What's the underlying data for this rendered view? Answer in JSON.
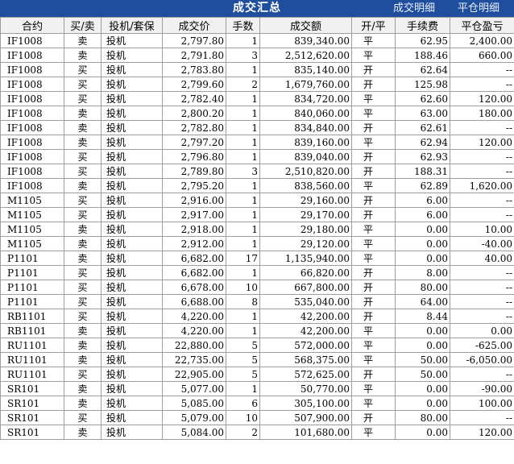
{
  "header": {
    "title": "成交汇总",
    "tab_detail": "成交明细",
    "tab_close_detail": "平仓明细"
  },
  "columns": [
    "合约",
    "买/卖",
    "投机/套保",
    "成交价",
    "手数",
    "成交额",
    "开/平",
    "手续费",
    "平仓盈亏"
  ],
  "rows": [
    [
      "IF1008",
      "卖",
      "投机",
      "2,797.80",
      "1",
      "839,340.00",
      "平",
      "62.95",
      "2,400.00"
    ],
    [
      "IF1008",
      "卖",
      "投机",
      "2,791.80",
      "3",
      "2,512,620.00",
      "平",
      "188.46",
      "660.00"
    ],
    [
      "IF1008",
      "买",
      "投机",
      "2,783.80",
      "1",
      "835,140.00",
      "开",
      "62.64",
      "--"
    ],
    [
      "IF1008",
      "买",
      "投机",
      "2,799.60",
      "2",
      "1,679,760.00",
      "开",
      "125.98",
      "--"
    ],
    [
      "IF1008",
      "买",
      "投机",
      "2,782.40",
      "1",
      "834,720.00",
      "平",
      "62.60",
      "120.00"
    ],
    [
      "IF1008",
      "卖",
      "投机",
      "2,800.20",
      "1",
      "840,060.00",
      "平",
      "63.00",
      "180.00"
    ],
    [
      "IF1008",
      "卖",
      "投机",
      "2,782.80",
      "1",
      "834,840.00",
      "开",
      "62.61",
      "--"
    ],
    [
      "IF1008",
      "卖",
      "投机",
      "2,797.20",
      "1",
      "839,160.00",
      "平",
      "62.94",
      "120.00"
    ],
    [
      "IF1008",
      "买",
      "投机",
      "2,796.80",
      "1",
      "839,040.00",
      "开",
      "62.93",
      "--"
    ],
    [
      "IF1008",
      "买",
      "投机",
      "2,789.80",
      "3",
      "2,510,820.00",
      "开",
      "188.31",
      "--"
    ],
    [
      "IF1008",
      "卖",
      "投机",
      "2,795.20",
      "1",
      "838,560.00",
      "平",
      "62.89",
      "1,620.00"
    ],
    [
      "M1105",
      "买",
      "投机",
      "2,916.00",
      "1",
      "29,160.00",
      "开",
      "6.00",
      "--"
    ],
    [
      "M1105",
      "买",
      "投机",
      "2,917.00",
      "1",
      "29,170.00",
      "开",
      "6.00",
      "--"
    ],
    [
      "M1105",
      "卖",
      "投机",
      "2,918.00",
      "1",
      "29,180.00",
      "平",
      "0.00",
      "10.00"
    ],
    [
      "M1105",
      "卖",
      "投机",
      "2,912.00",
      "1",
      "29,120.00",
      "平",
      "0.00",
      "-40.00"
    ],
    [
      "P1101",
      "卖",
      "投机",
      "6,682.00",
      "17",
      "1,135,940.00",
      "平",
      "0.00",
      "40.00"
    ],
    [
      "P1101",
      "买",
      "投机",
      "6,682.00",
      "1",
      "66,820.00",
      "开",
      "8.00",
      "--"
    ],
    [
      "P1101",
      "买",
      "投机",
      "6,678.00",
      "10",
      "667,800.00",
      "开",
      "80.00",
      "--"
    ],
    [
      "P1101",
      "买",
      "投机",
      "6,688.00",
      "8",
      "535,040.00",
      "开",
      "64.00",
      "--"
    ],
    [
      "RB1101",
      "买",
      "投机",
      "4,220.00",
      "1",
      "42,200.00",
      "开",
      "8.44",
      "--"
    ],
    [
      "RB1101",
      "卖",
      "投机",
      "4,220.00",
      "1",
      "42,200.00",
      "平",
      "0.00",
      "0.00"
    ],
    [
      "RU1101",
      "卖",
      "投机",
      "22,880.00",
      "5",
      "572,000.00",
      "平",
      "0.00",
      "-625.00"
    ],
    [
      "RU1101",
      "卖",
      "投机",
      "22,735.00",
      "5",
      "568,375.00",
      "平",
      "50.00",
      "-6,050.00"
    ],
    [
      "RU1101",
      "买",
      "投机",
      "22,905.00",
      "5",
      "572,625.00",
      "开",
      "50.00",
      "--"
    ],
    [
      "SR101",
      "卖",
      "投机",
      "5,077.00",
      "1",
      "50,770.00",
      "平",
      "0.00",
      "-90.00"
    ],
    [
      "SR101",
      "卖",
      "投机",
      "5,085.00",
      "6",
      "305,100.00",
      "平",
      "0.00",
      "100.00"
    ],
    [
      "SR101",
      "买",
      "投机",
      "5,079.00",
      "10",
      "507,900.00",
      "开",
      "80.00",
      "--"
    ],
    [
      "SR101",
      "卖",
      "投机",
      "5,084.00",
      "2",
      "101,680.00",
      "平",
      "0.00",
      "120.00"
    ]
  ]
}
